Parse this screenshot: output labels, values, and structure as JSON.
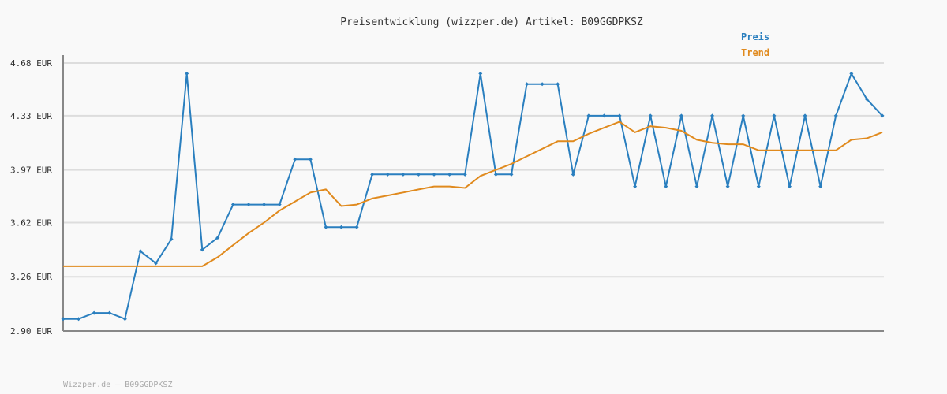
{
  "chart_data": {
    "type": "line",
    "title": "Preisentwicklung (wizzper.de) Artikel: B09GGDPKSZ",
    "xlabel": "",
    "ylabel": "",
    "ylim": [
      2.9,
      4.68
    ],
    "y_ticks": [
      "2.90 EUR",
      "3.26 EUR",
      "3.62 EUR",
      "3.97 EUR",
      "4.33 EUR",
      "4.68 EUR"
    ],
    "y_tick_values": [
      2.9,
      3.26,
      3.62,
      3.97,
      4.33,
      4.68
    ],
    "grid": true,
    "legend_position": "top-right",
    "x": [
      0,
      1,
      2,
      3,
      4,
      5,
      6,
      7,
      8,
      9,
      10,
      11,
      12,
      13,
      14,
      15,
      16,
      17,
      18,
      19,
      20,
      21,
      22,
      23,
      24,
      25,
      26,
      27,
      28,
      29,
      30,
      31,
      32,
      33,
      34,
      35,
      36,
      37,
      38,
      39,
      40,
      41,
      42,
      43,
      44,
      45,
      46,
      47,
      48,
      49,
      50,
      51,
      52,
      53
    ],
    "series": [
      {
        "name": "Preis",
        "color": "#2a7fbf",
        "values": [
          2.98,
          2.98,
          3.02,
          3.02,
          2.98,
          3.43,
          3.35,
          3.51,
          4.61,
          3.44,
          3.52,
          3.74,
          3.74,
          3.74,
          3.74,
          4.04,
          4.04,
          3.59,
          3.59,
          3.59,
          3.94,
          3.94,
          3.94,
          3.94,
          3.94,
          3.94,
          3.94,
          4.61,
          3.94,
          3.94,
          4.54,
          4.54,
          4.54,
          3.94,
          4.33,
          4.33,
          4.33,
          3.86,
          4.33,
          3.86,
          4.33,
          3.86,
          4.33,
          3.86,
          4.33,
          3.86,
          4.33,
          3.86,
          4.33,
          3.86,
          4.33,
          4.61,
          4.44,
          4.33
        ],
        "marker": "diamond"
      },
      {
        "name": "Trend",
        "color": "#e08a1e",
        "values": [
          3.33,
          3.33,
          3.33,
          3.33,
          3.33,
          3.33,
          3.33,
          3.33,
          3.33,
          3.33,
          3.39,
          3.47,
          3.55,
          3.62,
          3.7,
          3.76,
          3.82,
          3.84,
          3.73,
          3.74,
          3.78,
          3.8,
          3.82,
          3.84,
          3.86,
          3.86,
          3.85,
          3.93,
          3.97,
          4.01,
          4.06,
          4.11,
          4.16,
          4.16,
          4.21,
          4.25,
          4.29,
          4.22,
          4.26,
          4.25,
          4.23,
          4.17,
          4.15,
          4.14,
          4.14,
          4.1,
          4.1,
          4.1,
          4.1,
          4.1,
          4.1,
          4.17,
          4.18,
          4.22
        ]
      }
    ]
  },
  "footer": {
    "text": "Wizzper.de – B09GGDPKSZ"
  }
}
